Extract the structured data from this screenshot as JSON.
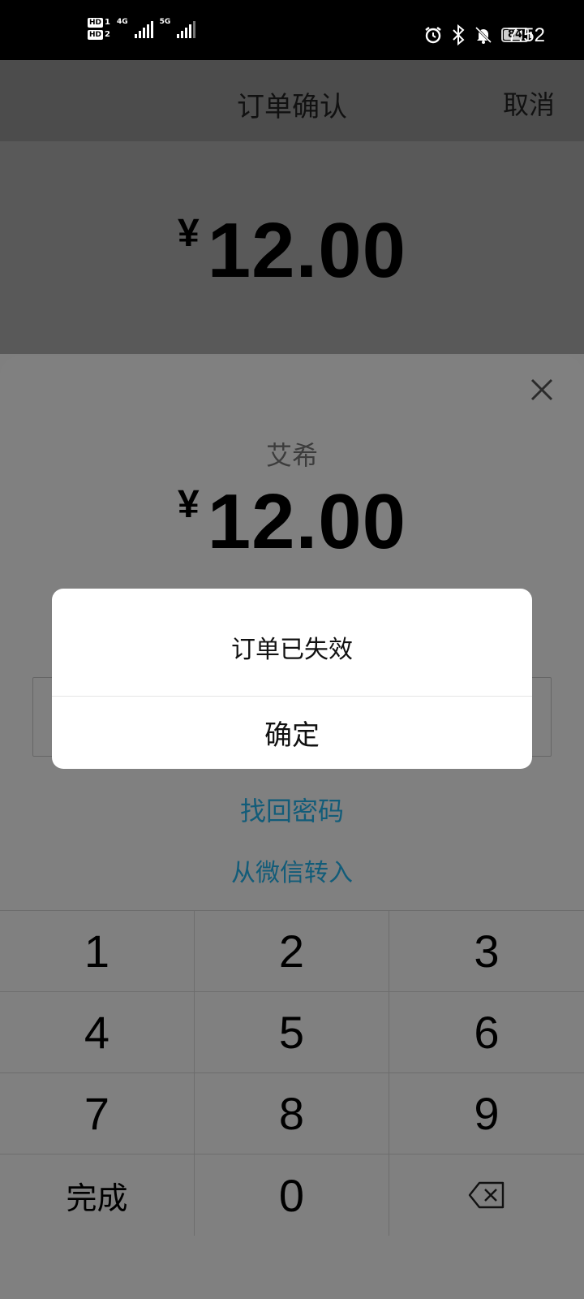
{
  "status_bar": {
    "sim1": "1",
    "sim2": "2",
    "hd_label": "HD",
    "net1": "4G",
    "net2": "5G",
    "battery": "84",
    "battery_level": 0.84,
    "time": "7:52",
    "icons": [
      "alarm-icon",
      "bluetooth-icon",
      "mute-icon",
      "battery-icon"
    ]
  },
  "header": {
    "title": "订单确认",
    "cancel": "取消"
  },
  "order": {
    "currency": "¥",
    "amount": "12.00"
  },
  "sheet": {
    "payee": "艾希",
    "currency": "¥",
    "amount": "12.00",
    "forgot_password": "找回密码",
    "transfer_from_wechat": "从微信转入"
  },
  "keypad": {
    "keys": [
      "1",
      "2",
      "3",
      "4",
      "5",
      "6",
      "7",
      "8",
      "9",
      "完成",
      "0"
    ],
    "backspace_icon": "backspace-icon"
  },
  "dialog": {
    "message": "订单已失效",
    "confirm": "确定"
  },
  "colors": {
    "link": "#125c79",
    "dialog_bg": "#ffffff",
    "overlay": "#808080"
  }
}
